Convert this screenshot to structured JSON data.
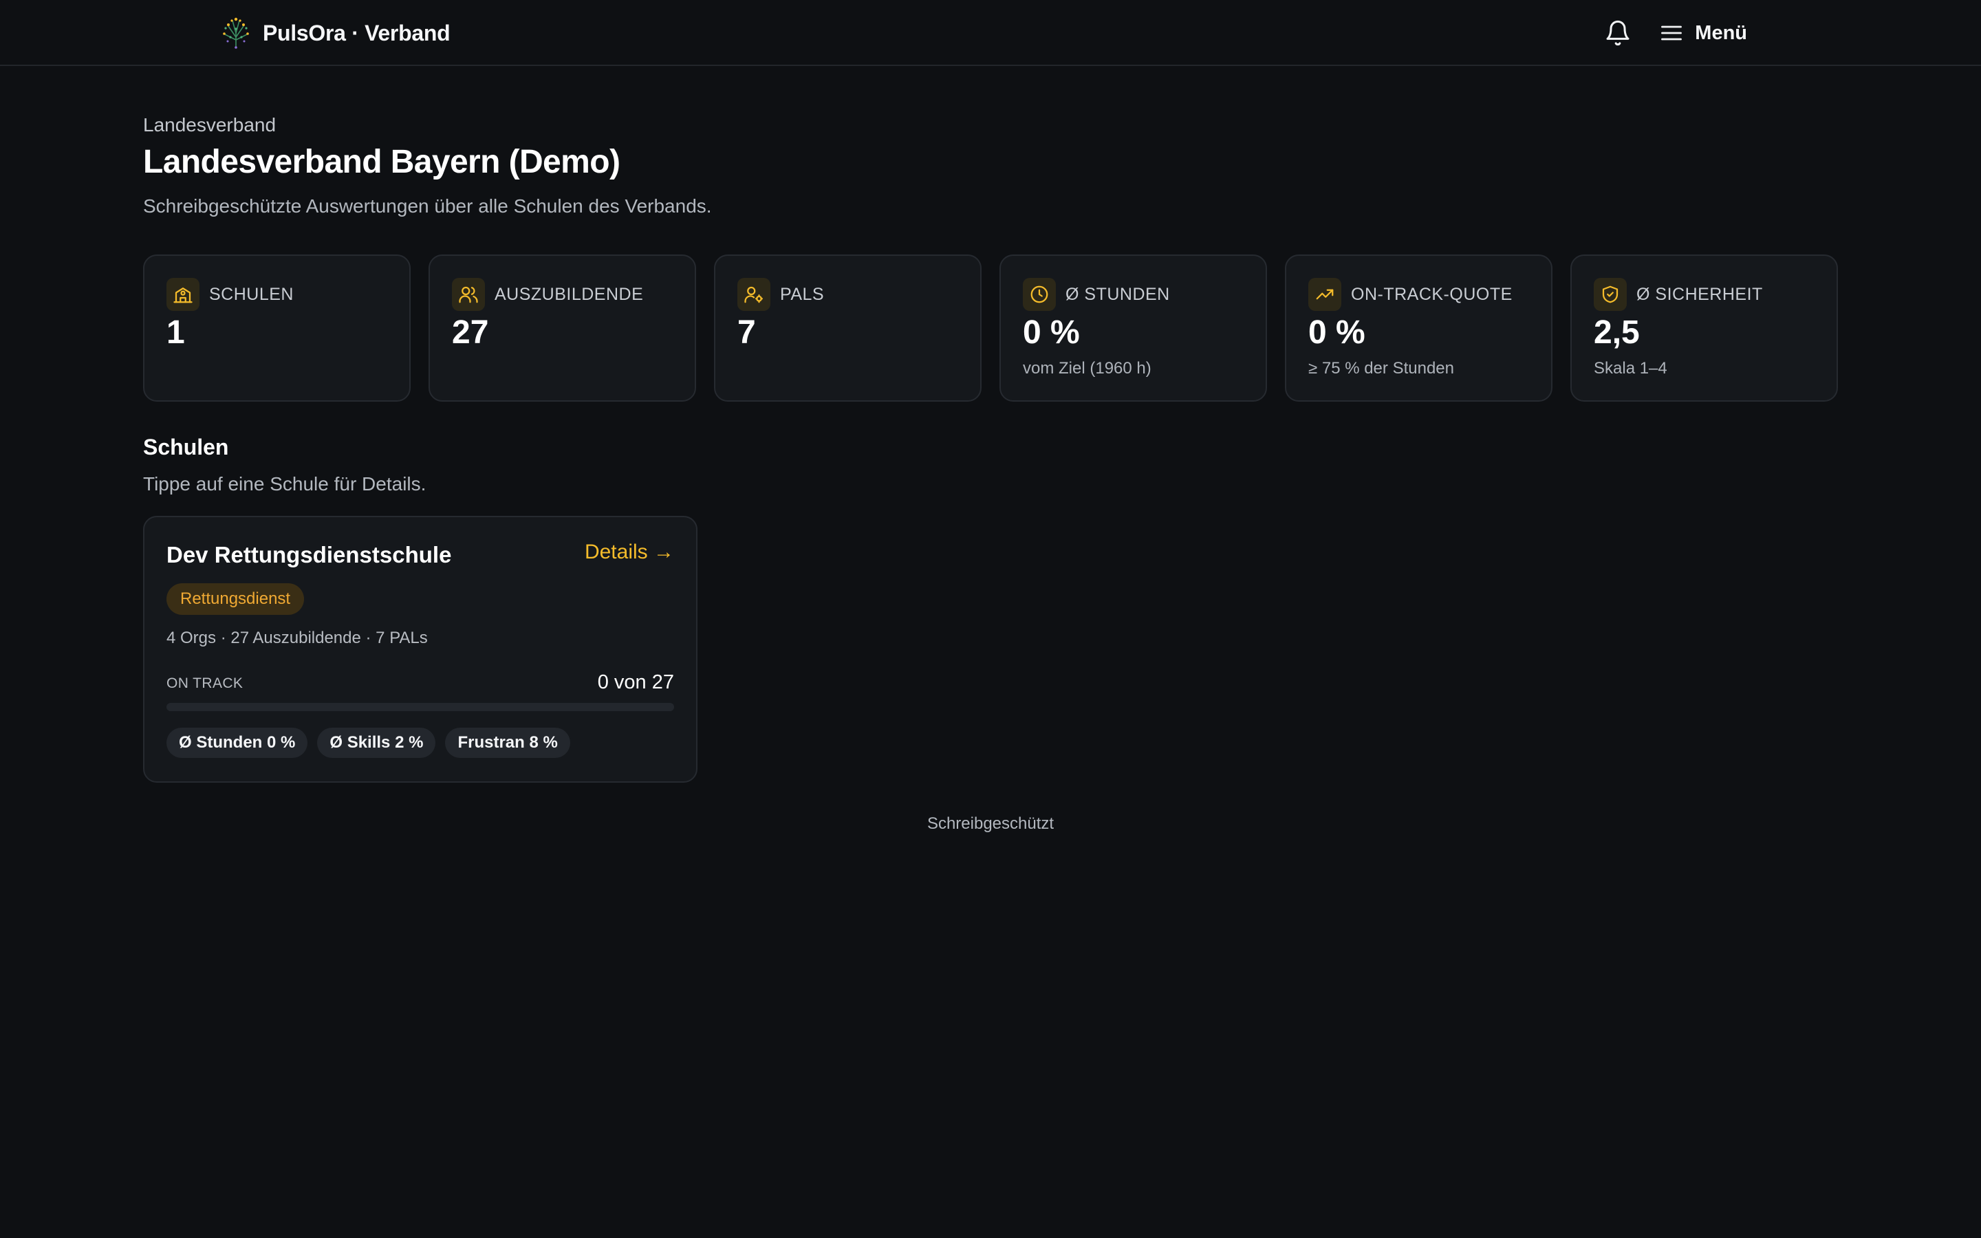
{
  "header": {
    "brand": "PulsOra · Verband",
    "menu_label": "Menü"
  },
  "page": {
    "eyebrow": "Landesverband",
    "title": "Landesverband Bayern (Demo)",
    "subtitle": "Schreibgeschützte Auswertungen über alle Schulen des Verbands."
  },
  "stats": [
    {
      "icon": "school-icon",
      "label": "SCHULEN",
      "value": "1",
      "sub": ""
    },
    {
      "icon": "users-icon",
      "label": "AUSZUBILDENDE",
      "value": "27",
      "sub": ""
    },
    {
      "icon": "user-cog-icon",
      "label": "PALS",
      "value": "7",
      "sub": ""
    },
    {
      "icon": "clock-icon",
      "label": "Ø STUNDEN",
      "value": "0 %",
      "sub": "vom Ziel (1960 h)"
    },
    {
      "icon": "trending-up-icon",
      "label": "ON-TRACK-QUOTE",
      "value": "0 %",
      "sub": "≥ 75 % der Stunden"
    },
    {
      "icon": "shield-check-icon",
      "label": "Ø SICHERHEIT",
      "value": "2,5",
      "sub": "Skala 1–4"
    }
  ],
  "schools_section": {
    "title": "Schulen",
    "hint": "Tippe auf eine Schule für Details."
  },
  "school": {
    "name": "Dev Rettungsdienstschule",
    "details_label": "Details →",
    "tag": "Rettungsdienst",
    "meta": "4 Orgs · 27 Auszubildende · 7 PALs",
    "track_label": "ON TRACK",
    "track_count": "0 von 27",
    "track_fraction": 0,
    "chips": [
      "Ø Stunden 0 %",
      "Ø Skills 2 %",
      "Frustran 8 %"
    ]
  },
  "footer_note": "Schreibgeschützt",
  "colors": {
    "background": "#0e1013",
    "card": "#15181c",
    "accent": "#f5bc2b",
    "tag_text": "#f0a933"
  }
}
